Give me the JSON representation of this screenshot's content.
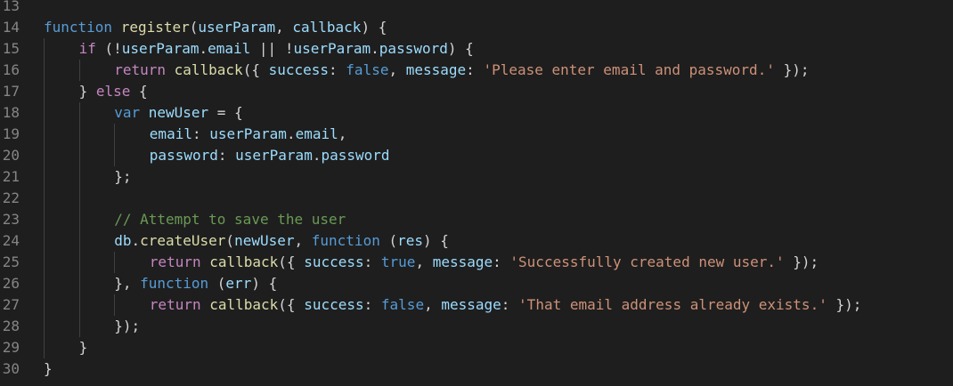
{
  "theme": {
    "background": "#1e1e1e",
    "default": "#d4d4d4",
    "line_number": "#858585",
    "keyword": "#569cd6",
    "control": "#c586c0",
    "function": "#dcdcaa",
    "variable": "#9cdcfe",
    "string": "#ce9178",
    "comment": "#6a9955",
    "indent_guide": "#404040"
  },
  "lines": [
    {
      "num": "13",
      "indent": 0,
      "tokens": []
    },
    {
      "num": "14",
      "indent": 0,
      "tokens": [
        {
          "t": "function",
          "c": "keyword"
        },
        {
          "t": " ",
          "c": "default"
        },
        {
          "t": "register",
          "c": "function"
        },
        {
          "t": "(",
          "c": "default"
        },
        {
          "t": "userParam",
          "c": "variable"
        },
        {
          "t": ", ",
          "c": "default"
        },
        {
          "t": "callback",
          "c": "variable"
        },
        {
          "t": ") {",
          "c": "default"
        }
      ]
    },
    {
      "num": "15",
      "indent": 1,
      "tokens": [
        {
          "t": "if",
          "c": "control"
        },
        {
          "t": " (!",
          "c": "default"
        },
        {
          "t": "userParam",
          "c": "variable"
        },
        {
          "t": ".",
          "c": "default"
        },
        {
          "t": "email",
          "c": "variable"
        },
        {
          "t": " || !",
          "c": "default"
        },
        {
          "t": "userParam",
          "c": "variable"
        },
        {
          "t": ".",
          "c": "default"
        },
        {
          "t": "password",
          "c": "variable"
        },
        {
          "t": ") {",
          "c": "default"
        }
      ]
    },
    {
      "num": "16",
      "indent": 2,
      "tokens": [
        {
          "t": "return",
          "c": "control"
        },
        {
          "t": " ",
          "c": "default"
        },
        {
          "t": "callback",
          "c": "function"
        },
        {
          "t": "({ ",
          "c": "default"
        },
        {
          "t": "success",
          "c": "variable"
        },
        {
          "t": ": ",
          "c": "default"
        },
        {
          "t": "false",
          "c": "keyword"
        },
        {
          "t": ", ",
          "c": "default"
        },
        {
          "t": "message",
          "c": "variable"
        },
        {
          "t": ": ",
          "c": "default"
        },
        {
          "t": "'Please enter email and password.'",
          "c": "string"
        },
        {
          "t": " });",
          "c": "default"
        }
      ]
    },
    {
      "num": "17",
      "indent": 1,
      "tokens": [
        {
          "t": "} ",
          "c": "default"
        },
        {
          "t": "else",
          "c": "control"
        },
        {
          "t": " {",
          "c": "default"
        }
      ]
    },
    {
      "num": "18",
      "indent": 2,
      "tokens": [
        {
          "t": "var",
          "c": "keyword"
        },
        {
          "t": " ",
          "c": "default"
        },
        {
          "t": "newUser",
          "c": "variable"
        },
        {
          "t": " = {",
          "c": "default"
        }
      ]
    },
    {
      "num": "19",
      "indent": 3,
      "tokens": [
        {
          "t": "email",
          "c": "variable"
        },
        {
          "t": ": ",
          "c": "default"
        },
        {
          "t": "userParam",
          "c": "variable"
        },
        {
          "t": ".",
          "c": "default"
        },
        {
          "t": "email",
          "c": "variable"
        },
        {
          "t": ",",
          "c": "default"
        }
      ]
    },
    {
      "num": "20",
      "indent": 3,
      "tokens": [
        {
          "t": "password",
          "c": "variable"
        },
        {
          "t": ": ",
          "c": "default"
        },
        {
          "t": "userParam",
          "c": "variable"
        },
        {
          "t": ".",
          "c": "default"
        },
        {
          "t": "password",
          "c": "variable"
        }
      ]
    },
    {
      "num": "21",
      "indent": 2,
      "tokens": [
        {
          "t": "};",
          "c": "default"
        }
      ]
    },
    {
      "num": "22",
      "indent": 0,
      "tokens": []
    },
    {
      "num": "23",
      "indent": 2,
      "tokens": [
        {
          "t": "// Attempt to save the user",
          "c": "comment"
        }
      ]
    },
    {
      "num": "24",
      "indent": 2,
      "tokens": [
        {
          "t": "db",
          "c": "variable"
        },
        {
          "t": ".",
          "c": "default"
        },
        {
          "t": "createUser",
          "c": "function"
        },
        {
          "t": "(",
          "c": "default"
        },
        {
          "t": "newUser",
          "c": "variable"
        },
        {
          "t": ", ",
          "c": "default"
        },
        {
          "t": "function",
          "c": "keyword"
        },
        {
          "t": " (",
          "c": "default"
        },
        {
          "t": "res",
          "c": "variable"
        },
        {
          "t": ") {",
          "c": "default"
        }
      ]
    },
    {
      "num": "25",
      "indent": 3,
      "tokens": [
        {
          "t": "return",
          "c": "control"
        },
        {
          "t": " ",
          "c": "default"
        },
        {
          "t": "callback",
          "c": "function"
        },
        {
          "t": "({ ",
          "c": "default"
        },
        {
          "t": "success",
          "c": "variable"
        },
        {
          "t": ": ",
          "c": "default"
        },
        {
          "t": "true",
          "c": "keyword"
        },
        {
          "t": ", ",
          "c": "default"
        },
        {
          "t": "message",
          "c": "variable"
        },
        {
          "t": ": ",
          "c": "default"
        },
        {
          "t": "'Successfully created new user.'",
          "c": "string"
        },
        {
          "t": " });",
          "c": "default"
        }
      ]
    },
    {
      "num": "26",
      "indent": 2,
      "tokens": [
        {
          "t": "}, ",
          "c": "default"
        },
        {
          "t": "function",
          "c": "keyword"
        },
        {
          "t": " (",
          "c": "default"
        },
        {
          "t": "err",
          "c": "variable"
        },
        {
          "t": ") {",
          "c": "default"
        }
      ]
    },
    {
      "num": "27",
      "indent": 3,
      "tokens": [
        {
          "t": "return",
          "c": "control"
        },
        {
          "t": " ",
          "c": "default"
        },
        {
          "t": "callback",
          "c": "function"
        },
        {
          "t": "({ ",
          "c": "default"
        },
        {
          "t": "success",
          "c": "variable"
        },
        {
          "t": ": ",
          "c": "default"
        },
        {
          "t": "false",
          "c": "keyword"
        },
        {
          "t": ", ",
          "c": "default"
        },
        {
          "t": "message",
          "c": "variable"
        },
        {
          "t": ": ",
          "c": "default"
        },
        {
          "t": "'That email address already exists.'",
          "c": "string"
        },
        {
          "t": " });",
          "c": "default"
        }
      ]
    },
    {
      "num": "28",
      "indent": 2,
      "tokens": [
        {
          "t": "});",
          "c": "default"
        }
      ]
    },
    {
      "num": "29",
      "indent": 1,
      "tokens": [
        {
          "t": "}",
          "c": "default"
        }
      ]
    },
    {
      "num": "30",
      "indent": 0,
      "tokens": [
        {
          "t": "}",
          "c": "default"
        }
      ]
    }
  ],
  "indent_guides": [
    {
      "level": 1,
      "from": "15",
      "to": "29"
    },
    {
      "level": 2,
      "from": "16",
      "to": "16"
    },
    {
      "level": 2,
      "from": "18",
      "to": "28"
    },
    {
      "level": 3,
      "from": "19",
      "to": "20"
    },
    {
      "level": 3,
      "from": "25",
      "to": "25"
    },
    {
      "level": 3,
      "from": "27",
      "to": "27"
    }
  ]
}
